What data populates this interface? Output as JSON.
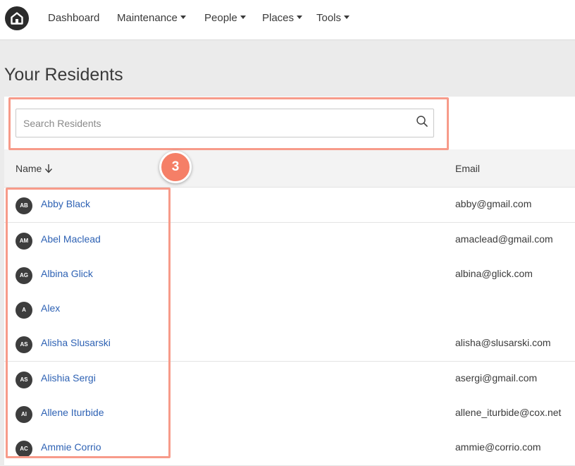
{
  "nav": {
    "items": [
      {
        "label": "Dashboard",
        "dropdown": false
      },
      {
        "label": "Maintenance",
        "dropdown": true
      },
      {
        "label": "People",
        "dropdown": true
      },
      {
        "label": "Places",
        "dropdown": true
      },
      {
        "label": "Tools",
        "dropdown": true
      }
    ]
  },
  "page": {
    "title": "Your Residents"
  },
  "search": {
    "placeholder": "Search Residents",
    "value": ""
  },
  "table": {
    "columns": {
      "name": "Name",
      "email": "Email"
    },
    "sort": {
      "column": "Name",
      "direction": "descending-arrow"
    },
    "rows": [
      {
        "initials": "AB",
        "name": "Abby Black",
        "email": "abby@gmail.com"
      },
      {
        "initials": "AM",
        "name": "Abel Maclead",
        "email": "amaclead@gmail.com"
      },
      {
        "initials": "AG",
        "name": "Albina Glick",
        "email": "albina@glick.com"
      },
      {
        "initials": "A",
        "name": "Alex",
        "email": ""
      },
      {
        "initials": "AS",
        "name": "Alisha Slusarski",
        "email": "alisha@slusarski.com"
      },
      {
        "initials": "AS",
        "name": "Alishia Sergi",
        "email": "asergi@gmail.com"
      },
      {
        "initials": "AI",
        "name": "Allene Iturbide",
        "email": "allene_iturbide@cox.net"
      },
      {
        "initials": "AC",
        "name": "Ammie Corrio",
        "email": "ammie@corrio.com"
      }
    ]
  },
  "annotation": {
    "step_number": "3",
    "highlight_color": "#f79b8a",
    "badge_color": "#f57f67"
  },
  "colors": {
    "link": "#2e62b4",
    "avatar": "#3d3d3d",
    "logo": "#2b2b2b"
  },
  "icons": {
    "logo": "home-icon",
    "search": "search-icon",
    "sort": "arrow-down-icon",
    "dropdown": "caret-down-icon"
  }
}
